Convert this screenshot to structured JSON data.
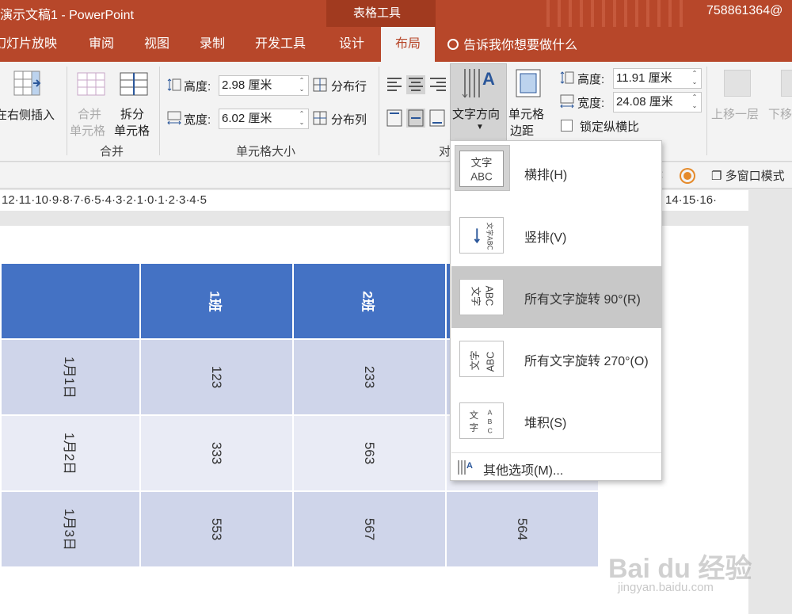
{
  "window": {
    "title": "演示文稿1  -  PowerPoint",
    "context_label": "表格工具",
    "user": "758861364@"
  },
  "tabs": [
    "幻灯片放映",
    "审阅",
    "视图",
    "录制",
    "开发工具",
    "设计",
    "布局"
  ],
  "active_tab": "布局",
  "tell_me": "告诉我你想要做什么",
  "ribbon": {
    "insert_right": "在右侧插入",
    "merge_cells": [
      "合并",
      "单元格"
    ],
    "split_cells": [
      "拆分",
      "单元格"
    ],
    "merge_group": "合并",
    "height_label": "高度:",
    "height_value": "2.98 厘米",
    "width_label": "宽度:",
    "width_value": "6.02 厘米",
    "distribute_rows": "分布行",
    "distribute_cols": "分布列",
    "cell_size_group": "单元格大小",
    "align_group": "对",
    "text_direction": "文字方向",
    "cell_margins": [
      "单元格",
      "边距"
    ],
    "table_height_label": "高度:",
    "table_height_value": "11.91 厘米",
    "table_width_label": "宽度:",
    "table_width_value": "24.08 厘米",
    "lock_ratio": "锁定纵横比",
    "bring_forward": "上移一层",
    "send_backward": "下移"
  },
  "toolbar2": {
    "multi_window": "多窗口模式"
  },
  "ruler": {
    "left": "12·11·10·9·8·7·6·5·4·3·2·1·0·1·2·3·4·5",
    "right": "14·15·16·"
  },
  "table": {
    "header": [
      "",
      "1班",
      "2班",
      ""
    ],
    "rows": [
      [
        "1月1日",
        "123",
        "233",
        ""
      ],
      [
        "1月2日",
        "333",
        "563",
        ""
      ],
      [
        "1月3日",
        "553",
        "567",
        "564"
      ]
    ]
  },
  "dropdown": {
    "items": [
      {
        "label": "横排(H)",
        "thumb": "文字ABC",
        "selected": false
      },
      {
        "label": "竖排(V)",
        "thumb": "文字ABC",
        "selected": false
      },
      {
        "label": "所有文字旋转 90°(R)",
        "thumb": "文字ABC",
        "selected": true
      },
      {
        "label": "所有文字旋转 270°(O)",
        "thumb": "文字ABC",
        "selected": false
      },
      {
        "label": "堆积(S)",
        "thumb": "文字ABC",
        "selected": false
      }
    ],
    "more": "其他选项(M)..."
  },
  "watermark": {
    "brand": "Bai du 经验",
    "url": "jingyan.baidu.com"
  },
  "colors": {
    "title_bar": "#b7472a",
    "table_header": "#4472c4",
    "row_odd": "#cfd5ea",
    "row_even": "#e9ebf5"
  }
}
